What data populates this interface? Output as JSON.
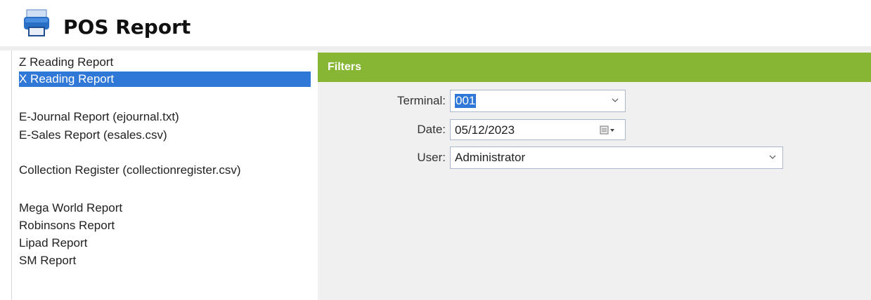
{
  "header": {
    "title": "POS Report",
    "icon": "printer-icon"
  },
  "sidebar": {
    "items": [
      {
        "label": "Z Reading Report",
        "selected": false
      },
      {
        "label": "X Reading Report",
        "selected": true
      },
      {
        "label": "E-Journal Report (ejournal.txt)",
        "selected": false
      },
      {
        "label": "E-Sales Report (esales.csv)",
        "selected": false
      },
      {
        "label": "Collection Register (collectionregister.csv)",
        "selected": false
      },
      {
        "label": "Mega World Report",
        "selected": false
      },
      {
        "label": "Robinsons Report",
        "selected": false
      },
      {
        "label": "Lipad Report",
        "selected": false
      },
      {
        "label": "SM Report",
        "selected": false
      }
    ]
  },
  "filters": {
    "title": "Filters",
    "accent_color": "#86b634",
    "terminal": {
      "label": "Terminal:",
      "value": "001"
    },
    "date": {
      "label": "Date:",
      "value": "05/12/2023"
    },
    "user": {
      "label": "User:",
      "value": "Administrator"
    }
  },
  "colors": {
    "selection": "#2f78d8",
    "panel_bg": "#f0f0f0"
  }
}
